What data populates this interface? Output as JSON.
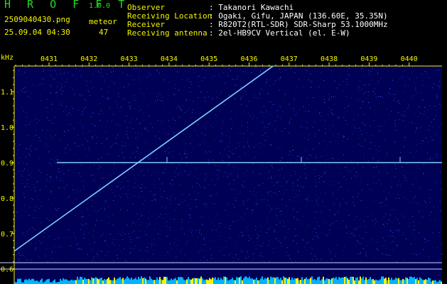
{
  "app": {
    "name": "H R O F F T",
    "version": "1.0.0"
  },
  "file": {
    "name": "2509040430.png",
    "datetime": "25.09.04 04:30"
  },
  "meteor": {
    "label": "meteor",
    "count": "47"
  },
  "station": {
    "observer_label": "Observer",
    "observer_value": ": Takanori Kawachi",
    "location_label": "Receiving Location",
    "location_value": ": Ogaki, Gifu, JAPAN (136.60E, 35.35N)",
    "receiver_label": "Receiver",
    "receiver_value": ": R820T2(RTL-SDR) SDR-Sharp 53.1000MHz",
    "antenna_label": "Receiving antenna",
    "antenna_value": ": 2el-HB9CV Vertical (el. E-W)"
  },
  "chart_data": {
    "type": "spectrogram",
    "ylabel": "kHz",
    "x_ticks": [
      "0431",
      "0432",
      "0433",
      "0434",
      "0435",
      "0436",
      "0437",
      "0438",
      "0439",
      "0440"
    ],
    "y_ticks": [
      "1.1",
      "1.0",
      "0.9",
      "0.8",
      "0.7",
      "0.6"
    ],
    "ylim": [
      0.58,
      1.2
    ],
    "carrier": {
      "freq_khz": 0.9,
      "start_time": "0431",
      "end_time": "0441"
    },
    "drift_trace": {
      "start": {
        "time": "0430.0",
        "freq_khz": 0.65
      },
      "end": {
        "time": "0436.6",
        "freq_khz": 1.2
      }
    },
    "colors": {
      "background": "#000055",
      "noise": "#2233cc",
      "signal": "#7fd0ff",
      "axis": "#f5f500",
      "activity": "#00b4ff"
    }
  }
}
